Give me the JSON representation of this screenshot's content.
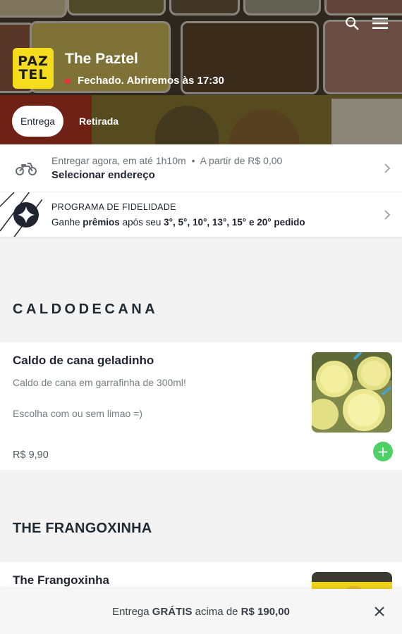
{
  "store": {
    "logo_top": "PAZ",
    "logo_bottom": "TEL",
    "name": "The Paztel",
    "status": "Fechado. Abriremos às 17:30",
    "status_color": "#e8323c",
    "brand_color": "#f5dc1d"
  },
  "header": {
    "icons": [
      "search-icon",
      "menu-icon"
    ]
  },
  "mode_tabs": [
    {
      "label": "Entrega",
      "active": true
    },
    {
      "label": "Retirada",
      "active": false
    }
  ],
  "delivery": {
    "icon": "motorcycle-icon",
    "time": "Entregar agora, em até 1h10m",
    "separator": "•",
    "min": "A partir de R$ 0,00",
    "address_label": "Selecionar endereço"
  },
  "loyalty": {
    "icon": "star-badge-icon",
    "title": "PROGRAMA DE FIDELIDADE",
    "sub_pre": "Ganhe ",
    "sub_bold1": "prêmios",
    "sub_mid": " após seu ",
    "sub_bold2": "3°, 5°, 10°, 13°, 15° e 20° pedido"
  },
  "sections": [
    {
      "title": "CALDODECANA",
      "products": [
        {
          "name": "Caldo de cana geladinho",
          "desc_line1": "Caldo de cana em garrafinha de 300ml!",
          "desc_line2": "Escolha com ou sem limao =)",
          "price": "R$ 9,90",
          "add_label": "+"
        }
      ]
    },
    {
      "title": "THE FRANGOXINHA",
      "products": [
        {
          "name": "The Frangoxinha"
        }
      ]
    }
  ],
  "banner": {
    "pre": "Entrega ",
    "bold1": "GRÁTIS",
    "mid": " acima de ",
    "bold2": "R$ 190,00",
    "accent": "#4fd067"
  }
}
